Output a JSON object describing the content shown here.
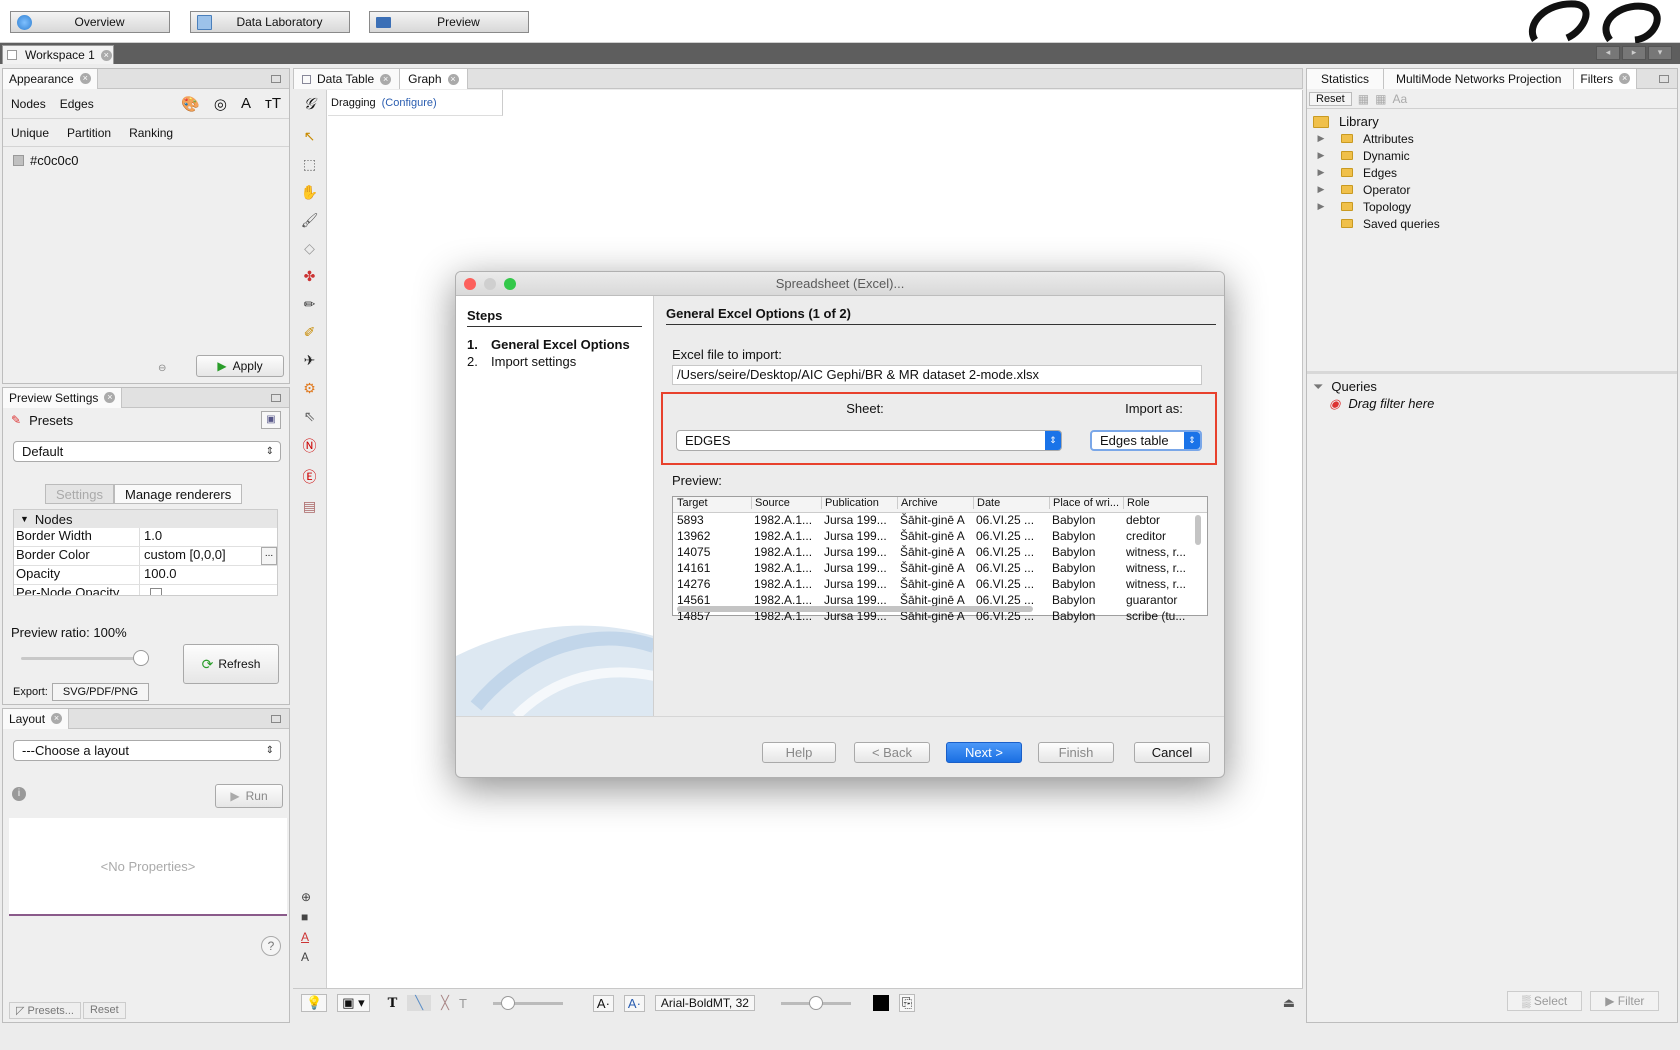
{
  "top": {
    "buttons": [
      {
        "label": "Overview",
        "icon": "globe-icon",
        "color": "#2f7fd1"
      },
      {
        "label": "Data Laboratory",
        "icon": "table-icon",
        "color": "#6fa2d8"
      },
      {
        "label": "Preview",
        "icon": "monitor-icon",
        "color": "#3b6fb6"
      }
    ]
  },
  "workspace": {
    "tab": "Workspace 1"
  },
  "appearance": {
    "tab": "Appearance",
    "mode_tabs": [
      "Nodes",
      "Edges"
    ],
    "sub_tabs": [
      "Unique",
      "Partition",
      "Ranking"
    ],
    "color_value": "#c0c0c0",
    "apply": "Apply"
  },
  "preview_settings": {
    "tab": "Preview Settings",
    "presets_label": "Presets",
    "preset_value": "Default",
    "tabs": [
      "Settings",
      "Manage renderers"
    ],
    "section": "Nodes",
    "props": [
      {
        "name": "Border Width",
        "value": "1.0"
      },
      {
        "name": "Border Color",
        "value": "custom [0,0,0]"
      },
      {
        "name": "Opacity",
        "value": "100.0"
      },
      {
        "name": "Per-Node Opacity",
        "value": ""
      }
    ],
    "ratio_label": "Preview ratio:",
    "ratio_value": "100%",
    "ratio_fraction": 1.0,
    "refresh": "Refresh",
    "export_label": "Export:",
    "export_value": "SVG/PDF/PNG",
    "ellipsis": "..."
  },
  "layout": {
    "tab": "Layout",
    "choose": "---Choose a layout",
    "run": "Run",
    "no_props": "<No Properties>",
    "presets": "Presets...",
    "reset": "Reset",
    "help": "?"
  },
  "center": {
    "tabs": [
      "Data Table",
      "Graph"
    ],
    "mode": "Dragging",
    "configure": "(Configure)",
    "font": "Arial-BoldMT, 32"
  },
  "right": {
    "tabs": [
      "Statistics",
      "MultiMode Networks Projection",
      "Filters"
    ],
    "reset": "Reset",
    "library": "Library",
    "items": [
      "Attributes",
      "Dynamic",
      "Edges",
      "Operator",
      "Topology",
      "Saved queries"
    ],
    "queries": "Queries",
    "drag_hint": "Drag filter here",
    "select": "Select",
    "filter": "Filter"
  },
  "dialog": {
    "title": "Spreadsheet (Excel)...",
    "steps_title": "Steps",
    "steps": [
      {
        "num": "1.",
        "label": "General Excel Options"
      },
      {
        "num": "2.",
        "label": "Import settings"
      }
    ],
    "heading": "General Excel Options (1 of 2)",
    "file_label": "Excel file to import:",
    "file_path": "/Users/seire/Desktop/AIC Gephi/BR & MR dataset 2-mode.xlsx",
    "sheet_label": "Sheet:",
    "sheet_value": "EDGES",
    "import_label": "Import as:",
    "import_value": "Edges table",
    "preview_label": "Preview:",
    "columns": [
      "Target",
      "Source",
      "Publication",
      "Archive",
      "Date",
      "Place of wri...",
      "Role"
    ],
    "rows": [
      [
        "5893",
        "1982.A.1...",
        "Jursa 199...",
        "Šāhit-ginē A",
        "06.VI.25 ...",
        "Babylon",
        "debtor"
      ],
      [
        "13962",
        "1982.A.1...",
        "Jursa 199...",
        "Šāhit-ginē A",
        "06.VI.25 ...",
        "Babylon",
        "creditor"
      ],
      [
        "14075",
        "1982.A.1...",
        "Jursa 199...",
        "Šāhit-ginē A",
        "06.VI.25 ...",
        "Babylon",
        "witness, r..."
      ],
      [
        "14161",
        "1982.A.1...",
        "Jursa 199...",
        "Šāhit-ginē A",
        "06.VI.25 ...",
        "Babylon",
        "witness, r..."
      ],
      [
        "14276",
        "1982.A.1...",
        "Jursa 199...",
        "Šāhit-ginē A",
        "06.VI.25 ...",
        "Babylon",
        "witness, r..."
      ],
      [
        "14561",
        "1982.A.1...",
        "Jursa 199...",
        "Šāhit-ginē A",
        "06.VI.25 ...",
        "Babylon",
        "guarantor"
      ],
      [
        "14857",
        "1982.A.1...",
        "Jursa 199...",
        "Šāhit-ginē A",
        "06.VI.25 ...",
        "Babylon",
        "scribe (tu..."
      ]
    ],
    "buttons": {
      "help": "Help",
      "back": "< Back",
      "next": "Next >",
      "finish": "Finish",
      "cancel": "Cancel"
    },
    "highlight_color": "#e8412c",
    "accent": "#1a73e8"
  }
}
